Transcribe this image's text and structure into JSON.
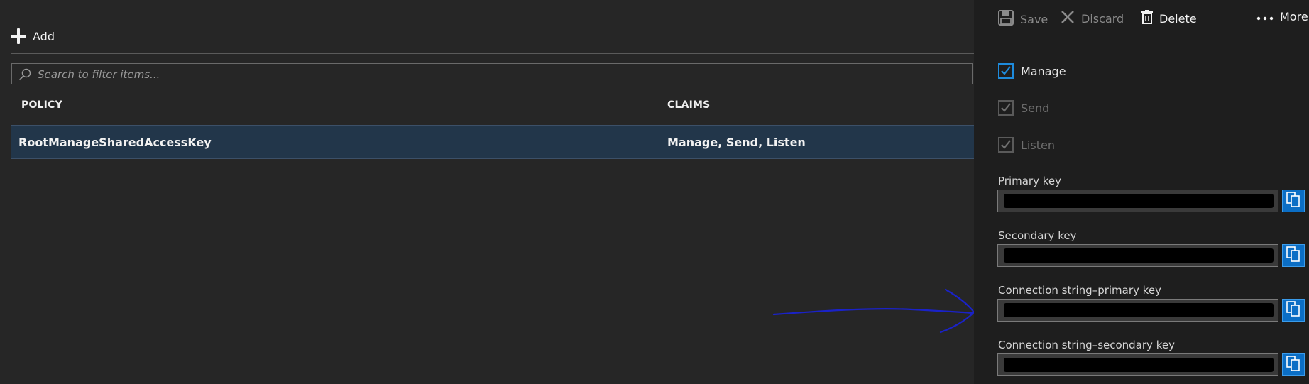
{
  "toolbar": {
    "add_label": "Add"
  },
  "search": {
    "placeholder": "Search to filter items...",
    "value": ""
  },
  "table": {
    "columns": [
      "POLICY",
      "CLAIMS"
    ],
    "rows": [
      {
        "policy": "RootManageSharedAccessKey",
        "claims": "Manage, Send, Listen"
      }
    ]
  },
  "panel": {
    "commands": {
      "save": "Save",
      "discard": "Discard",
      "delete": "Delete",
      "more": "More"
    },
    "claims": [
      {
        "label": "Manage",
        "checked": true,
        "enabled": true
      },
      {
        "label": "Send",
        "checked": true,
        "enabled": false
      },
      {
        "label": "Listen",
        "checked": true,
        "enabled": false
      }
    ],
    "fields": [
      {
        "label": "Primary key"
      },
      {
        "label": "Secondary key"
      },
      {
        "label": "Connection string–primary key"
      },
      {
        "label": "Connection string–secondary key"
      }
    ]
  },
  "colors": {
    "background": "#262626",
    "panel": "#1e1e1e",
    "selected_row": "#22364a",
    "accent": "#0b6ec5",
    "checkbox_accent": "#1e8bdc",
    "annotation": "#1a22c8"
  },
  "icons": {
    "add": "plus-icon",
    "search": "search-icon",
    "save": "floppy-disk-icon",
    "discard": "x-icon",
    "delete": "trash-icon",
    "more": "ellipsis-icon",
    "copy": "copy-icon"
  }
}
